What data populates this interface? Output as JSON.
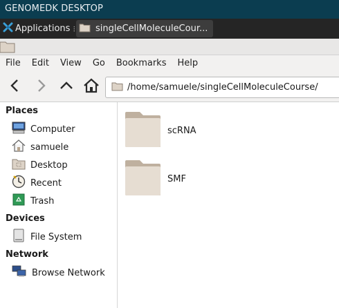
{
  "topbar": {
    "title": "GENOMEDK DESKTOP"
  },
  "taskbar": {
    "applications_label": "Applications",
    "separator": "⁝",
    "task_title": "singleCellMoleculeCour..."
  },
  "menubar": {
    "items": [
      "File",
      "Edit",
      "View",
      "Go",
      "Bookmarks",
      "Help"
    ]
  },
  "toolbar": {
    "location_path": "/home/samuele/singleCellMoleculeCourse/"
  },
  "sidebar": {
    "places_heading": "Places",
    "places": [
      {
        "label": "Computer",
        "icon": "computer-icon"
      },
      {
        "label": "samuele",
        "icon": "home-icon"
      },
      {
        "label": "Desktop",
        "icon": "desktop-folder-icon"
      },
      {
        "label": "Recent",
        "icon": "clock-icon"
      },
      {
        "label": "Trash",
        "icon": "trash-icon"
      }
    ],
    "devices_heading": "Devices",
    "devices": [
      {
        "label": "File System",
        "icon": "drive-icon"
      }
    ],
    "network_heading": "Network",
    "network": [
      {
        "label": "Browse Network",
        "icon": "network-icon"
      }
    ]
  },
  "content": {
    "items": [
      {
        "name": "scRNA",
        "type": "folder"
      },
      {
        "name": "SMF",
        "type": "folder"
      }
    ]
  }
}
